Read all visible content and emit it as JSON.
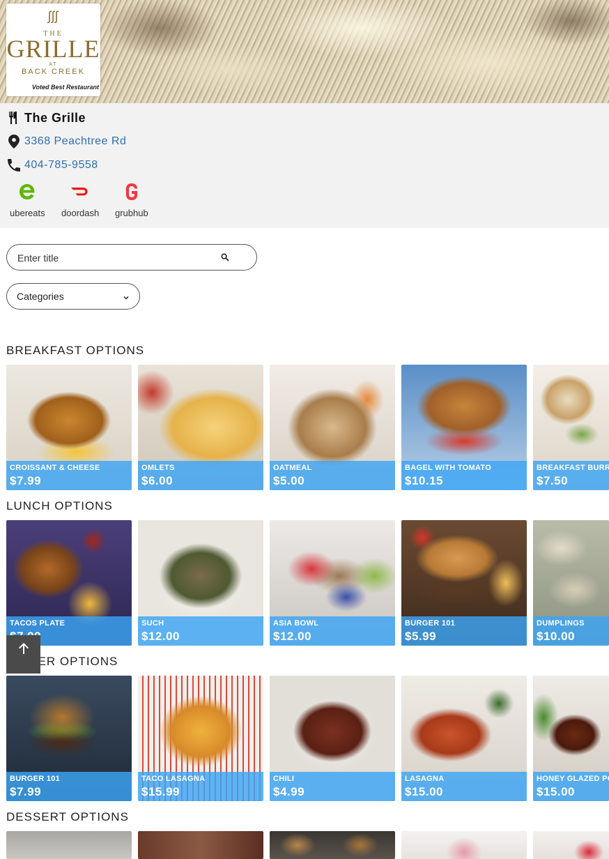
{
  "restaurant": {
    "logo": {
      "brand_the": "THE",
      "brand_name": "GRILLE",
      "brand_at": "AT",
      "brand_location": "BACK CREEK",
      "tagline": "Voted Best Restaurant"
    },
    "name": "The Grille",
    "address": "3368 Peachtree Rd",
    "phone": "404-785-9558",
    "delivery": [
      {
        "label": "ubereats",
        "icon": "ubereats-icon",
        "color": "#5fb709"
      },
      {
        "label": "doordash",
        "icon": "doordash-icon",
        "color": "#eb1700"
      },
      {
        "label": "grubhub",
        "icon": "grubhub-icon",
        "color": "#f63440"
      }
    ]
  },
  "search": {
    "placeholder": "Enter title",
    "value": ""
  },
  "categories_select": {
    "selected": "Categories"
  },
  "sections": [
    {
      "title": "BREAKFAST OPTIONS",
      "items": [
        {
          "name": "CROISSANT & CHEESE",
          "price": "$7.99"
        },
        {
          "name": "OMLETS",
          "price": "$6.00"
        },
        {
          "name": "OATMEAL",
          "price": "$5.00"
        },
        {
          "name": "BAGEL WITH TOMATO",
          "price": "$10.15"
        },
        {
          "name": "BREAKFAST BURRI",
          "price": "$7.50"
        }
      ]
    },
    {
      "title": "LUNCH OPTIONS",
      "items": [
        {
          "name": "TACOS PLATE",
          "price": "$7.99"
        },
        {
          "name": "SUCH",
          "price": "$12.00"
        },
        {
          "name": "ASIA BOWL",
          "price": "$12.00"
        },
        {
          "name": "BURGER 101",
          "price": "$5.99"
        },
        {
          "name": "DUMPLINGS",
          "price": "$10.00"
        }
      ]
    },
    {
      "title": "DINNER OPTIONS",
      "items": [
        {
          "name": "BURGER 101",
          "price": "$7.99"
        },
        {
          "name": "TACO LASAGNA",
          "price": "$15.99"
        },
        {
          "name": "CHILI",
          "price": "$4.99"
        },
        {
          "name": "LASAGNA",
          "price": "$15.00"
        },
        {
          "name": "HONEY GLAZED PO",
          "price": "$15.00"
        }
      ]
    },
    {
      "title": "DESSERT OPTIONS",
      "items": [
        {
          "name": "",
          "price": ""
        },
        {
          "name": "",
          "price": ""
        },
        {
          "name": "",
          "price": ""
        },
        {
          "name": "",
          "price": ""
        },
        {
          "name": "",
          "price": ""
        }
      ]
    }
  ],
  "colors": {
    "accent": "#3ca5f5",
    "link": "#2f6fb2",
    "info_bg": "#f2f2f2"
  }
}
